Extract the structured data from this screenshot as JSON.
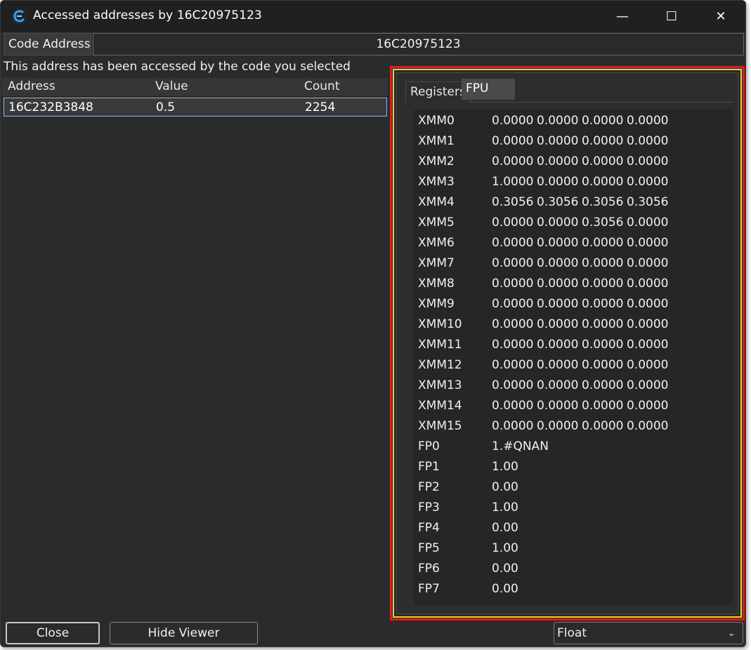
{
  "window": {
    "title": "Accessed addresses by 16C20975123",
    "controls": {
      "minimize": "—",
      "maximize": "☐",
      "close": "✕"
    }
  },
  "code_address": {
    "label": "Code Address",
    "value": "16C20975123"
  },
  "info_text": "This address has been accessed by the code you selected",
  "list": {
    "columns": [
      "Address",
      "Value",
      "Count"
    ],
    "rows": [
      {
        "address": "16C232B3848",
        "value": "0.5",
        "count": "2254"
      }
    ]
  },
  "fpu_panel": {
    "tabs": [
      "Registers",
      "FPU"
    ],
    "active_tab": "FPU",
    "xmm": [
      {
        "name": "XMM0",
        "values": [
          "0.0000",
          "0.0000",
          "0.0000",
          "0.0000"
        ]
      },
      {
        "name": "XMM1",
        "values": [
          "0.0000",
          "0.0000",
          "0.0000",
          "0.0000"
        ]
      },
      {
        "name": "XMM2",
        "values": [
          "0.0000",
          "0.0000",
          "0.0000",
          "0.0000"
        ]
      },
      {
        "name": "XMM3",
        "values": [
          "1.0000",
          "0.0000",
          "0.0000",
          "0.0000"
        ]
      },
      {
        "name": "XMM4",
        "values": [
          "0.3056",
          "0.3056",
          "0.3056",
          "0.3056"
        ]
      },
      {
        "name": "XMM5",
        "values": [
          "0.0000",
          "0.0000",
          "0.3056",
          "0.0000"
        ]
      },
      {
        "name": "XMM6",
        "values": [
          "0.0000",
          "0.0000",
          "0.0000",
          "0.0000"
        ]
      },
      {
        "name": "XMM7",
        "values": [
          "0.0000",
          "0.0000",
          "0.0000",
          "0.0000"
        ]
      },
      {
        "name": "XMM8",
        "values": [
          "0.0000",
          "0.0000",
          "0.0000",
          "0.0000"
        ]
      },
      {
        "name": "XMM9",
        "values": [
          "0.0000",
          "0.0000",
          "0.0000",
          "0.0000"
        ]
      },
      {
        "name": "XMM10",
        "values": [
          "0.0000",
          "0.0000",
          "0.0000",
          "0.0000"
        ]
      },
      {
        "name": "XMM11",
        "values": [
          "0.0000",
          "0.0000",
          "0.0000",
          "0.0000"
        ]
      },
      {
        "name": "XMM12",
        "values": [
          "0.0000",
          "0.0000",
          "0.0000",
          "0.0000"
        ]
      },
      {
        "name": "XMM13",
        "values": [
          "0.0000",
          "0.0000",
          "0.0000",
          "0.0000"
        ]
      },
      {
        "name": "XMM14",
        "values": [
          "0.0000",
          "0.0000",
          "0.0000",
          "0.0000"
        ]
      },
      {
        "name": "XMM15",
        "values": [
          "0.0000",
          "0.0000",
          "0.0000",
          "0.0000"
        ]
      }
    ],
    "fp": [
      {
        "name": "FP0",
        "value": "1.#QNAN"
      },
      {
        "name": "FP1",
        "value": "1.00"
      },
      {
        "name": "FP2",
        "value": "0.00"
      },
      {
        "name": "FP3",
        "value": "1.00"
      },
      {
        "name": "FP4",
        "value": "0.00"
      },
      {
        "name": "FP5",
        "value": "1.00"
      },
      {
        "name": "FP6",
        "value": "0.00"
      },
      {
        "name": "FP7",
        "value": "0.00"
      }
    ]
  },
  "buttons": {
    "close": "Close",
    "hide_viewer": "Hide Viewer"
  },
  "format_select": {
    "selected": "Float"
  },
  "icons": {
    "app": "cheat-engine-icon",
    "dropdown": "chevron-down-icon"
  },
  "colors": {
    "highlight_border": "#e11b1b",
    "highlight_outline": "#ffd200",
    "selection_border": "#8cb8e0"
  }
}
